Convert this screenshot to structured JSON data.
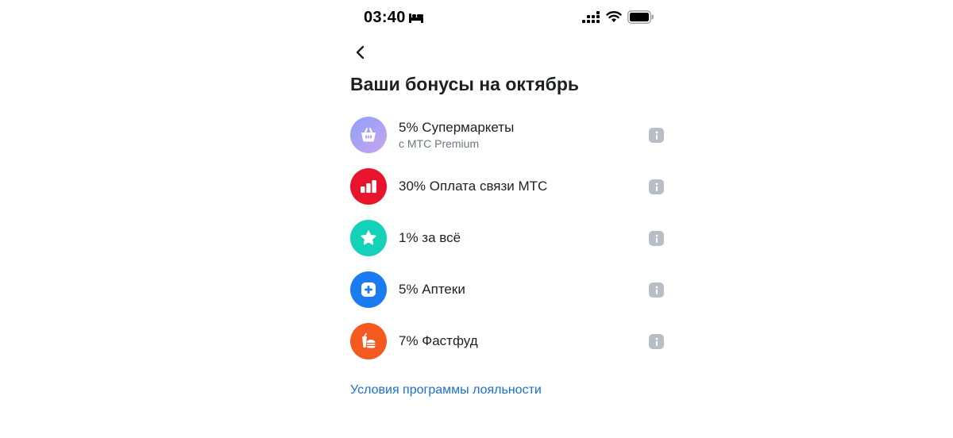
{
  "status_bar": {
    "time": "03:40",
    "icons": [
      "bed-icon",
      "signal-icon",
      "wifi-icon",
      "battery-icon"
    ]
  },
  "header": {
    "back_icon": "chevron-left-icon",
    "title": "Ваши бонусы на октябрь"
  },
  "bonuses": [
    {
      "label": "5% Супермаркеты",
      "sublabel": "с МТС Premium",
      "icon": "basket-icon",
      "color_from": "#9aa6f7",
      "color_to": "#c4a6f2"
    },
    {
      "label": "30% Оплата связи МТС",
      "sublabel": "",
      "icon": "bar-chart-icon",
      "color": "#e8142d"
    },
    {
      "label": "1% за всё",
      "sublabel": "",
      "icon": "star-icon",
      "color": "#14d2b8"
    },
    {
      "label": "5% Аптеки",
      "sublabel": "",
      "icon": "plus-icon",
      "color": "#1a7cf0"
    },
    {
      "label": "7% Фастфуд",
      "sublabel": "",
      "icon": "fastfood-icon",
      "color": "#f45a1f"
    }
  ],
  "footer": {
    "loyalty_link": "Условия программы лояльности"
  },
  "colors": {
    "link": "#1c6fd0",
    "text": "#1d2023",
    "secondary_text": "#6e7782",
    "info_badge": "#b8bec6"
  }
}
